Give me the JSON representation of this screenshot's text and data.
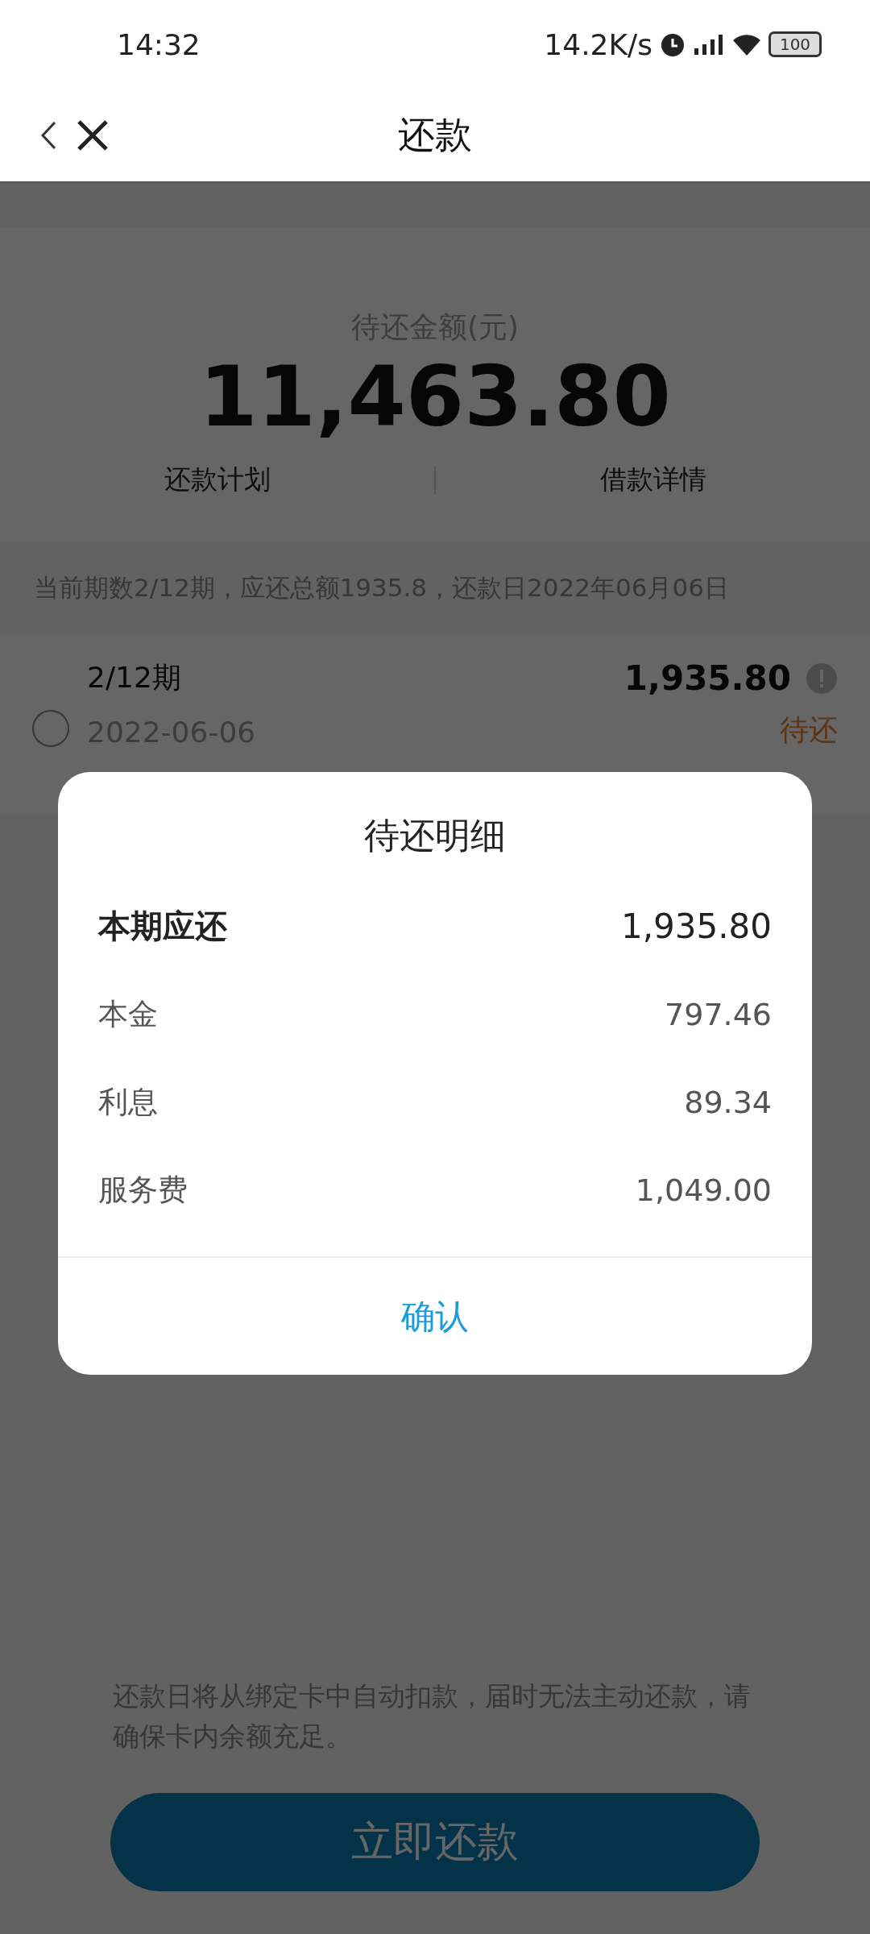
{
  "status_bar": {
    "time": "14:32",
    "net_speed": "14.2K/s",
    "battery": "100"
  },
  "nav": {
    "title": "还款"
  },
  "summary": {
    "label": "待还金额(元)",
    "amount": "11,463.80",
    "tabs": [
      {
        "label": "还款计划"
      },
      {
        "label": "借款详情"
      }
    ]
  },
  "notice": "当前期数2/12期，应还总额1935.8，还款日2022年06月06日",
  "installments": [
    {
      "period": "2/12期",
      "date": "2022-06-06",
      "amount": "1,935.80",
      "status": "待还",
      "selected": false
    }
  ],
  "footer_note": "还款日将从绑定卡中自动扣款，届时无法主动还款，请确保卡内余额充足。",
  "pay_button": "立即还款",
  "dialog": {
    "title": "待还明细",
    "rows": [
      {
        "label": "本期应还",
        "value": "1,935.80",
        "kind": "total"
      },
      {
        "label": "本金",
        "value": "797.46",
        "kind": "item"
      },
      {
        "label": "利息",
        "value": "89.34",
        "kind": "item"
      },
      {
        "label": "服务费",
        "value": "1,049.00",
        "kind": "item"
      }
    ],
    "confirm": "确认"
  }
}
